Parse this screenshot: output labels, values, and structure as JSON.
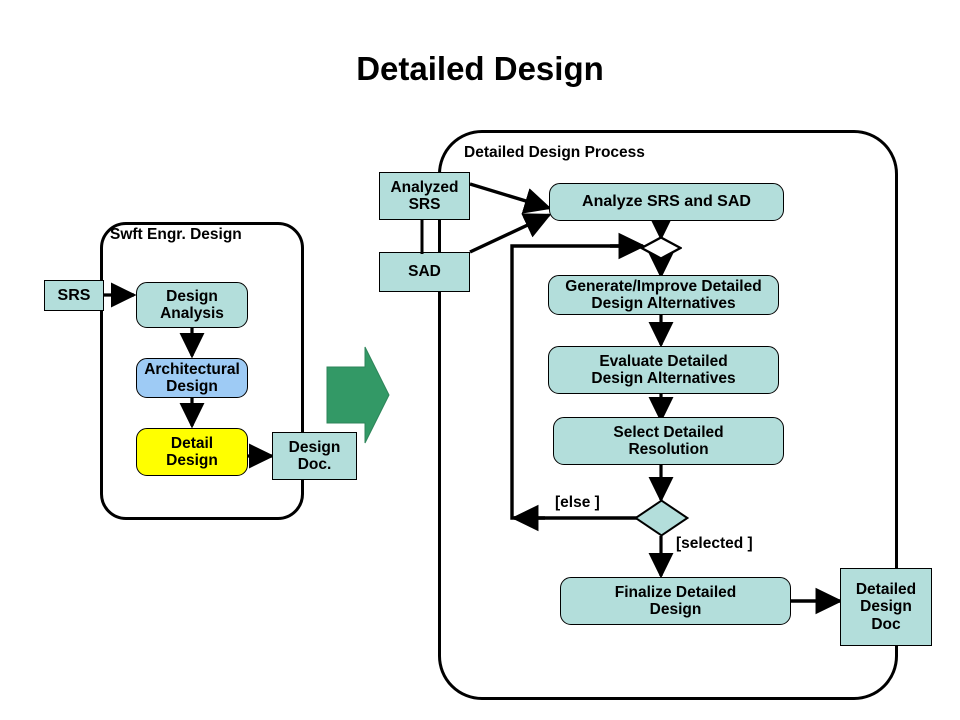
{
  "slide": {
    "title": "Detailed Design"
  },
  "left_panel": {
    "label": "Swft Engr. Design",
    "nodes": {
      "srs": "SRS",
      "design_analysis": "Design\nAnalysis",
      "design_analysis_line1": "Design",
      "design_analysis_line2": "Analysis",
      "architectural_design_line1": "Architectural",
      "architectural_design_line2": "Design",
      "detail_design_line1": "Detail",
      "detail_design_line2": "Design",
      "design_doc_line1": "Design",
      "design_doc_line2": "Doc."
    },
    "colors": {
      "artifact_fill": "#b3dedb",
      "architectural_fill": "#9ecbf5",
      "detail_fill": "#ffff00",
      "border": "#000000"
    }
  },
  "transition": {
    "arrow_name": "green-block-arrow",
    "color": "#339966"
  },
  "right_panel": {
    "label": "Detailed Design Process",
    "inputs": {
      "analyzed_srs_line1": "Analyzed",
      "analyzed_srs_line2": "SRS",
      "sad": "SAD"
    },
    "activities": {
      "analyze": "Analyze SRS and SAD",
      "generate_line1": "Generate/Improve Detailed",
      "generate_line2": "Design Alternatives",
      "evaluate_line1": "Evaluate Detailed",
      "evaluate_line2": "Design Alternatives",
      "select_line1": "Select Detailed",
      "select_line2": "Resolution",
      "finalize_line1": "Finalize Detailed",
      "finalize_line2": "Design"
    },
    "output": {
      "doc_line1": "Detailed",
      "doc_line2": "Design",
      "doc_line3": "Doc"
    },
    "edge_labels": {
      "else": "[else ]",
      "selected": "[selected ]"
    },
    "colors": {
      "activity_fill": "#b3dedb",
      "decision_fill": "#b3dedb",
      "merge_fill": "#ffffff",
      "border": "#000000"
    }
  }
}
